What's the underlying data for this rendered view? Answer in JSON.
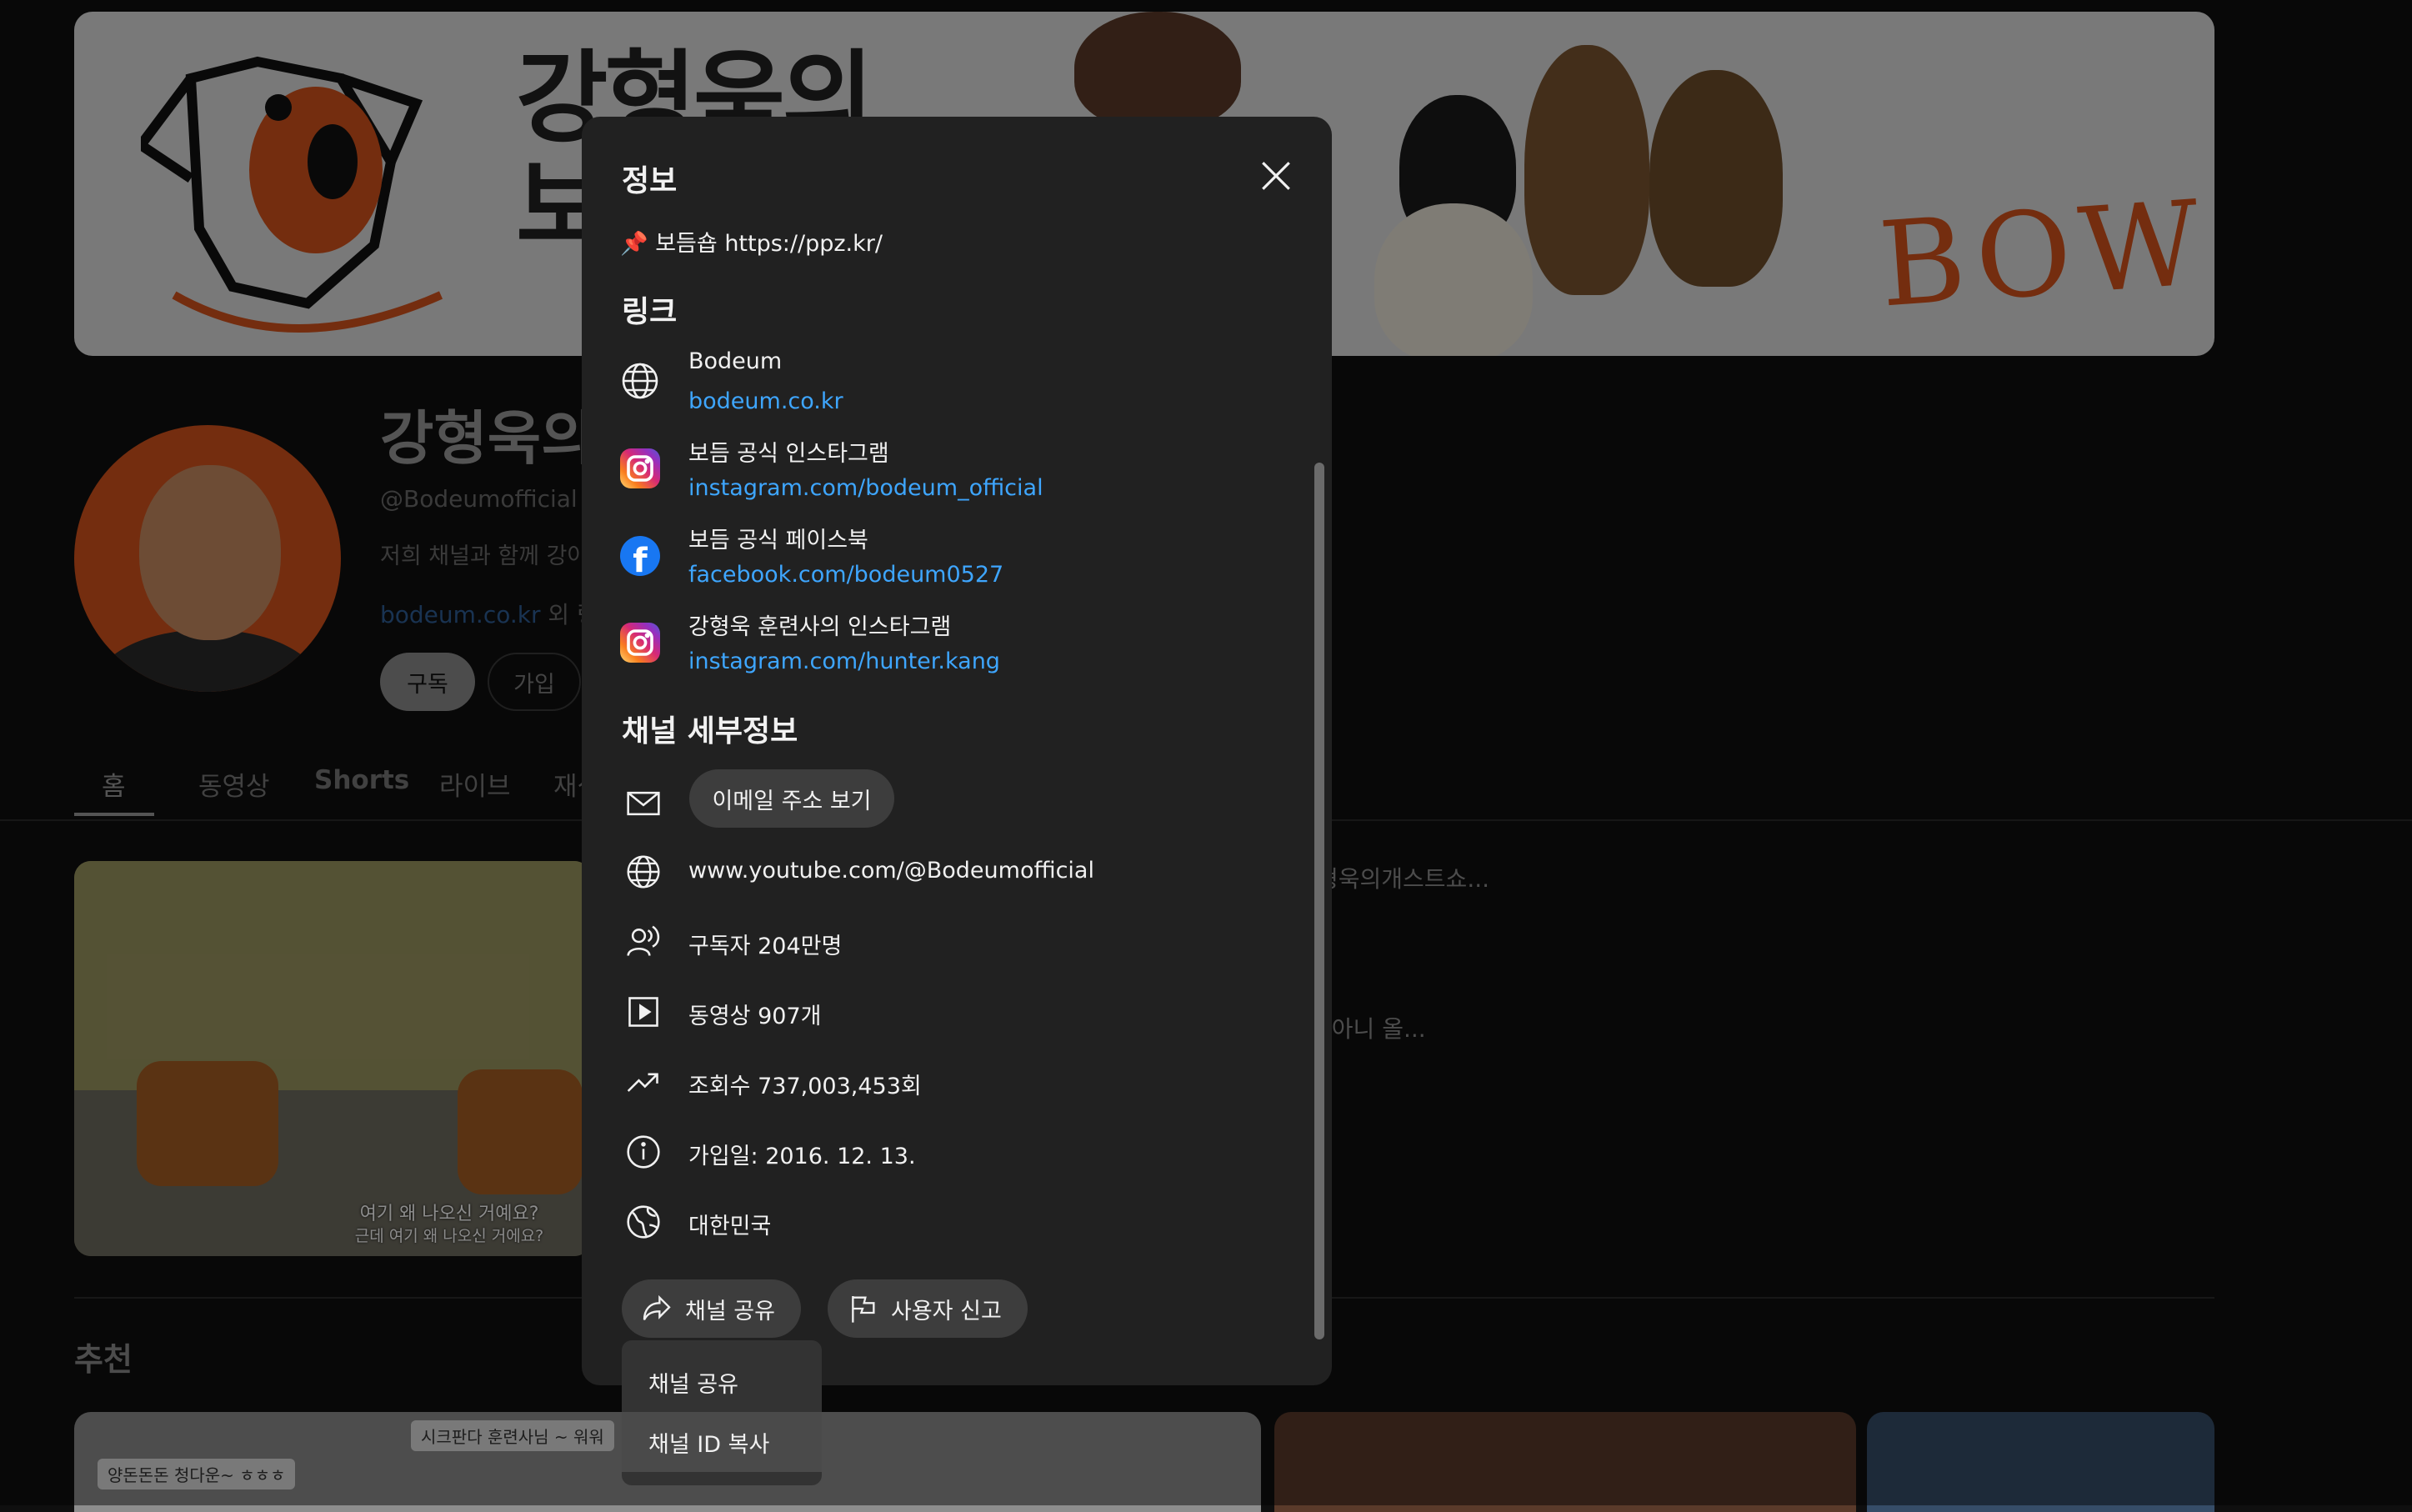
{
  "banner": {
    "title_line": "강형욱의",
    "title_line2": "보",
    "bow_text": "BOW"
  },
  "channel": {
    "name": "강형욱의",
    "handle": "@Bodeumofficial ·",
    "description": "저희 채널과 함께 강아",
    "links_summary_link": "bodeum.co.kr",
    "links_summary_rest": " 외 링크"
  },
  "buttons": {
    "subscribe": "구독",
    "join": "가입"
  },
  "tabs": [
    "홈",
    "동영상",
    "Shorts",
    "라이브",
    "재생"
  ],
  "featured_video": {
    "caption_top": "여기 왜 나오신 거예요?",
    "caption_bottom": "근데 여기 왜 나오신 거에요?",
    "info_line1": "형욱의개스트쇼...",
    "info_line2": ". 아니 올..."
  },
  "recommended": {
    "heading": "추천",
    "thumb1_caption1": "양돈돈돈 청다운~ ㅎㅎㅎ",
    "thumb1_caption2": "시크판다 훈련사님 ~ 워워"
  },
  "dialog": {
    "title": "정보",
    "pinned_icon": "📌",
    "pinned_text": "보듬숍 https://ppz.kr/",
    "links_heading": "링크",
    "links": [
      {
        "icon": "globe-icon",
        "title": "Bodeum",
        "url": "bodeum.co.kr"
      },
      {
        "icon": "instagram-icon",
        "title": "보듬 공식 인스타그램",
        "url": "instagram.com/bodeum_official"
      },
      {
        "icon": "facebook-icon",
        "title": "보듬 공식 페이스북",
        "url": "facebook.com/bodeum0527"
      },
      {
        "icon": "instagram-icon",
        "title": "강형욱 훈련사의 인스타그램",
        "url": "instagram.com/hunter.kang"
      }
    ],
    "details_heading": "채널 세부정보",
    "email_button": "이메일 주소 보기",
    "details": {
      "url": "www.youtube.com/@Bodeumofficial",
      "subscribers": "구독자 204만명",
      "videos": "동영상 907개",
      "views": "조회수 737,003,453회",
      "joined": "가입일: 2016. 12. 13.",
      "country": "대한민국"
    },
    "share_button": "채널 공유",
    "report_button": "사용자 신고"
  },
  "share_menu": {
    "items": [
      "채널 공유",
      "채널 ID 복사"
    ]
  },
  "colors": {
    "link_blue": "#3ea6ff",
    "accent_orange": "#d4521c",
    "dialog_bg": "#212121"
  }
}
